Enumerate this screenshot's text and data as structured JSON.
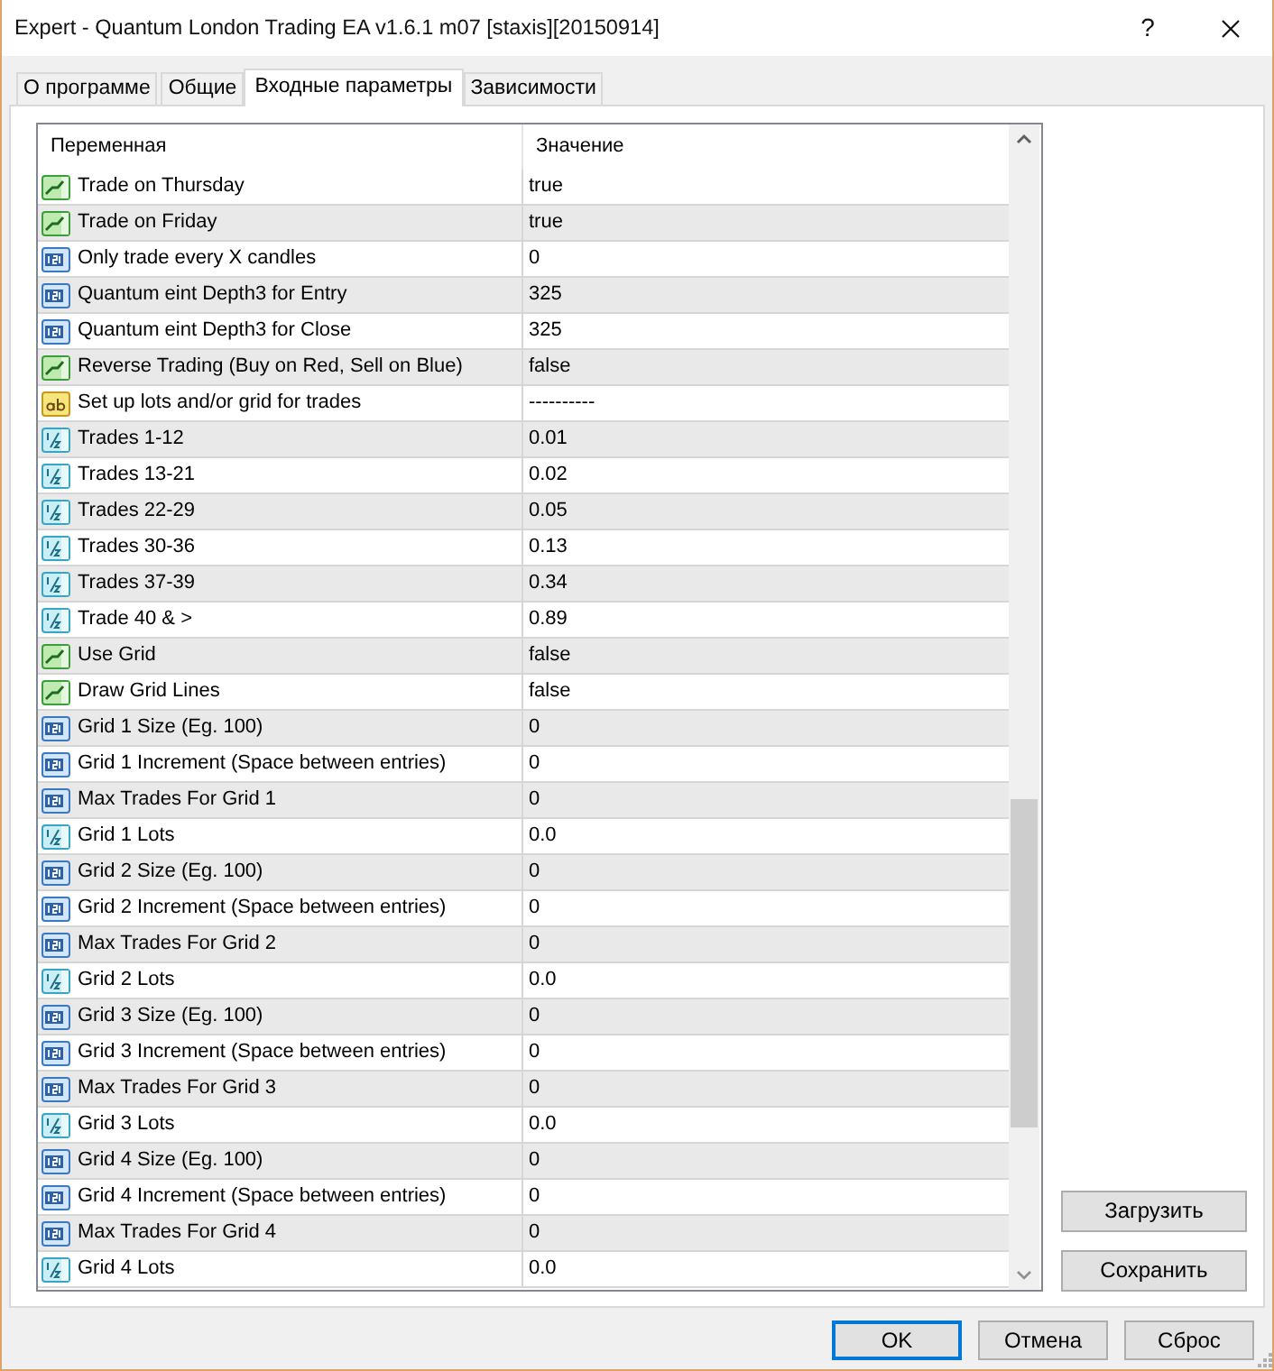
{
  "window": {
    "title": "Expert - Quantum London Trading EA v1.6.1 m07 [staxis][20150914]",
    "help": "?"
  },
  "tabs": [
    {
      "label": "О программе",
      "selected": false
    },
    {
      "label": "Общие",
      "selected": false
    },
    {
      "label": "Входные параметры",
      "selected": true
    },
    {
      "label": "Зависимости",
      "selected": false
    }
  ],
  "parameters": {
    "columns": [
      "Переменная",
      "Значение"
    ],
    "rows": [
      {
        "kind": "bool",
        "name": "Trade on Thursday",
        "value": "true"
      },
      {
        "kind": "bool",
        "name": "Trade on Friday",
        "value": "true"
      },
      {
        "kind": "int",
        "name": "Only trade every X candles",
        "value": "0"
      },
      {
        "kind": "int",
        "name": "Quantum eint Depth3 for Entry",
        "value": "325"
      },
      {
        "kind": "int",
        "name": "Quantum eint Depth3 for Close",
        "value": "325"
      },
      {
        "kind": "bool",
        "name": "Reverse Trading (Buy on Red, Sell on Blue)",
        "value": "false"
      },
      {
        "kind": "string",
        "name": "Set up lots and/or grid for trades",
        "value": "----------"
      },
      {
        "kind": "double",
        "name": "Trades 1-12",
        "value": "0.01"
      },
      {
        "kind": "double",
        "name": "Trades 13-21",
        "value": "0.02"
      },
      {
        "kind": "double",
        "name": "Trades 22-29",
        "value": "0.05"
      },
      {
        "kind": "double",
        "name": "Trades 30-36",
        "value": "0.13"
      },
      {
        "kind": "double",
        "name": "Trades 37-39",
        "value": "0.34"
      },
      {
        "kind": "double",
        "name": "Trade 40 & >",
        "value": "0.89"
      },
      {
        "kind": "bool",
        "name": "Use Grid",
        "value": "false"
      },
      {
        "kind": "bool",
        "name": "Draw Grid Lines",
        "value": "false"
      },
      {
        "kind": "int",
        "name": "Grid 1 Size (Eg. 100)",
        "value": "0"
      },
      {
        "kind": "int",
        "name": "Grid 1 Increment (Space between entries)",
        "value": "0"
      },
      {
        "kind": "int",
        "name": "Max Trades For Grid 1",
        "value": "0"
      },
      {
        "kind": "double",
        "name": "Grid 1 Lots",
        "value": "0.0"
      },
      {
        "kind": "int",
        "name": "Grid 2 Size (Eg. 100)",
        "value": "0"
      },
      {
        "kind": "int",
        "name": "Grid 2 Increment (Space between entries)",
        "value": "0"
      },
      {
        "kind": "int",
        "name": "Max Trades For Grid 2",
        "value": "0"
      },
      {
        "kind": "double",
        "name": "Grid 2 Lots",
        "value": "0.0"
      },
      {
        "kind": "int",
        "name": "Grid 3 Size (Eg. 100)",
        "value": "0"
      },
      {
        "kind": "int",
        "name": "Grid 3 Increment (Space between entries)",
        "value": "0"
      },
      {
        "kind": "int",
        "name": "Max Trades For Grid 3",
        "value": "0"
      },
      {
        "kind": "double",
        "name": "Grid 3 Lots",
        "value": "0.0"
      },
      {
        "kind": "int",
        "name": "Grid 4 Size (Eg. 100)",
        "value": "0"
      },
      {
        "kind": "int",
        "name": "Grid 4 Increment (Space between entries)",
        "value": "0"
      },
      {
        "kind": "int",
        "name": "Max Trades For Grid 4",
        "value": "0"
      },
      {
        "kind": "double",
        "name": "Grid 4 Lots",
        "value": "0.0"
      }
    ]
  },
  "side_buttons": [
    "Загрузить",
    "Сохранить"
  ],
  "buttons": [
    {
      "label": "OK",
      "default": true
    },
    {
      "label": "Отмена",
      "default": false
    },
    {
      "label": "Сброс",
      "default": false
    }
  ]
}
